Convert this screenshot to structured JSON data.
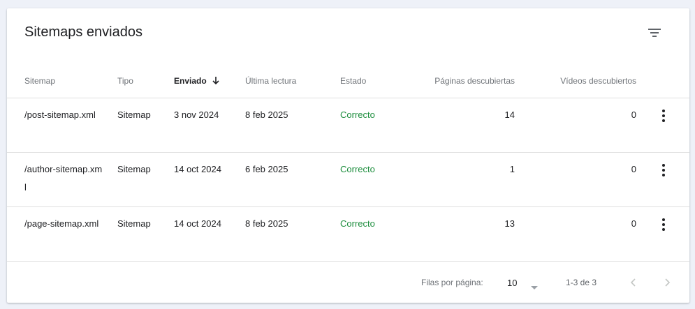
{
  "card": {
    "title": "Sitemaps enviados"
  },
  "table": {
    "headers": {
      "sitemap": "Sitemap",
      "tipo": "Tipo",
      "enviado": "Enviado",
      "lectura": "Última lectura",
      "estado": "Estado",
      "paginas": "Páginas descubiertas",
      "videos": "Vídeos descubiertos"
    },
    "sort_column": "enviado",
    "sort_direction": "descending",
    "rows": [
      {
        "sitemap": "/post-sitemap.xml",
        "tipo": "Sitemap",
        "enviado": "3 nov 2024",
        "lectura": "8 feb 2025",
        "estado": "Correcto",
        "paginas": "14",
        "videos": "0"
      },
      {
        "sitemap": "/author-sitemap.xml",
        "tipo": "Sitemap",
        "enviado": "14 oct 2024",
        "lectura": "6 feb 2025",
        "estado": "Correcto",
        "paginas": "1",
        "videos": "0"
      },
      {
        "sitemap": "/page-sitemap.xml",
        "tipo": "Sitemap",
        "enviado": "14 oct 2024",
        "lectura": "8 feb 2025",
        "estado": "Correcto",
        "paginas": "13",
        "videos": "0"
      }
    ]
  },
  "footer": {
    "rows_per_page_label": "Filas por página:",
    "rows_per_page_value": "10",
    "range": "1-3 de 3"
  },
  "colors": {
    "status_ok": "#1e8e3e",
    "background": "#eef1f8"
  },
  "icons": {
    "filter": "filter-icon",
    "sort": "arrow-down-icon",
    "more": "more-vert-icon",
    "prev": "chevron-left-icon",
    "next": "chevron-right-icon",
    "dropdown": "caret-down-icon"
  }
}
